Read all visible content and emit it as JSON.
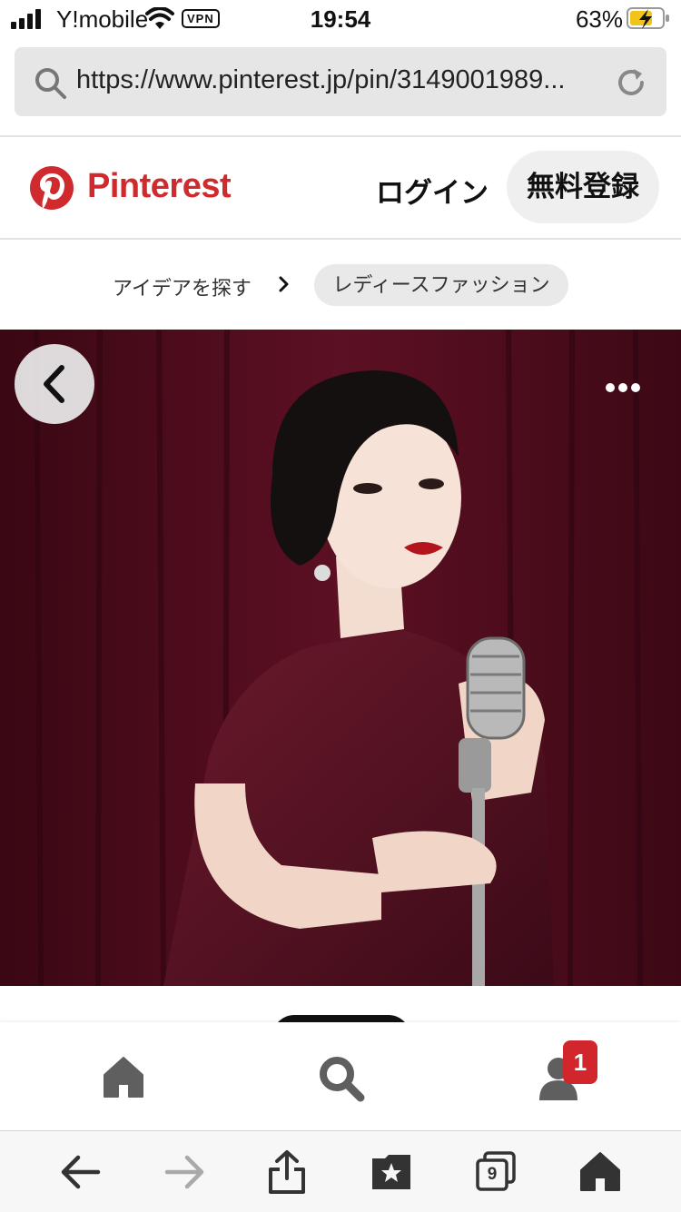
{
  "status_bar": {
    "carrier": "Y!mobile",
    "vpn": "VPN",
    "time": "19:54",
    "battery": "63%"
  },
  "browser": {
    "url": "https://www.pinterest.jp/pin/3149001989...",
    "tab_count": "9"
  },
  "header": {
    "brand": "Pinterest",
    "brand_color": "#cf2b2f",
    "login": "ログイン",
    "signup": "無料登録"
  },
  "breadcrumb": {
    "explore": "アイデアを探す",
    "category": "レディースファッション"
  },
  "bottom_nav": {
    "notification_count": "1",
    "badge_color": "#d0262c"
  },
  "icons": {
    "search": "search-icon",
    "reload": "reload-icon",
    "back": "chevron-left-icon",
    "more": "more-horizontal-icon",
    "home": "home-icon",
    "profile": "profile-icon",
    "share": "share-icon",
    "bookmarks": "bookmarks-icon"
  }
}
